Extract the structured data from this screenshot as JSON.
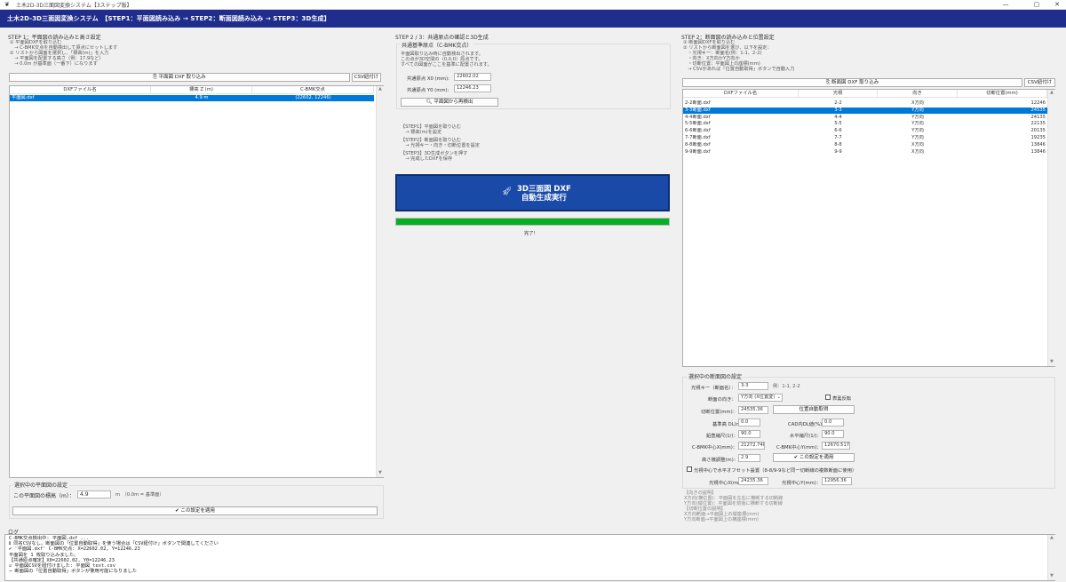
{
  "window": {
    "title": "土木2D-3D三面図変換システム【3ステップ版】",
    "controls": [
      "—",
      "▢",
      "✕"
    ]
  },
  "header": {
    "text": "土木2D-3D三面図変換システム　【STEP1：平面図読み込み → STEP2：断面図読み込み → STEP3：3D生成】"
  },
  "left": {
    "title": "STEP 1：平面図の読み込みと高さ設定",
    "instructions": [
      "① 平面図DXFを取り込む",
      "　→ C-BMK交点を自動検出して原点にセットします",
      "② リストから図面を選択し、「標高(m)」を入力",
      "　→ 平面図を配置する高さ（例：17.9など）",
      "　→ 0.0m が基準面（一番下）になります"
    ],
    "import_button": "平面図 DXF 取り込み",
    "csv_button": "CSV紐付け",
    "table": {
      "headers": [
        "DXFファイル名",
        "標高 Z (m)",
        "C-BMK交点"
      ],
      "rows": [
        [
          "平面図.dxf",
          "4.9 m",
          "(22602, 12246)"
        ]
      ]
    },
    "selected_group_title": "選択中の平面図の設定",
    "elevation_label": "この平面図の標高（m）：",
    "elevation_value": "4.9",
    "elevation_hint": "m　（0.0m = 基準面）",
    "apply_button": "✔ この設定を適用"
  },
  "middle": {
    "title": "STEP 2 / 3：共通原点の確認と3D生成",
    "origin_group_title": "共通基準原点（C-BMK交点）",
    "origin_desc": [
      "平面図取り込み時に自動検出されます。",
      "この点が3D空間の（0,0,0）原点です。",
      "すべての図面がここを基準に配置されます。"
    ],
    "x0_label": "共通原点 X0 (mm):",
    "x0_value": "22602.02",
    "y0_label": "共通原点 Y0 (mm):",
    "y0_value": "12246.23",
    "redetect_button": "平面図から再検出",
    "steps": [
      "【STEP1】平面図を取り込む",
      "　→ 標高(m)を設定",
      "【STEP2】断面図を取り込む",
      "　→ 光視キー・向き・切断位置を設定",
      "【STEP3】3D生成ボタンを押す",
      "　→ 完成したDXFを保存"
    ],
    "generate_line1": "3D三面図 DXF",
    "generate_line2": "自動生成実行",
    "progress": 1.0,
    "progress_text": "完了!"
  },
  "right": {
    "title": "STEP 2：断面図の読み込みと位置設定",
    "instructions": [
      "① 断面図DXFを取り込む",
      "② リストから断面図を選び、以下を設定：",
      "　・光視キー：断面名(例：1-1、2-2)",
      "　・向き：X方向かY方向か",
      "　・切断位置：平面図上の座標(mm)",
      "　→ CSVがあれば「位置自動取得」ボタンで自動入力"
    ],
    "import_button": "断面図 DXF 取り込み",
    "csv_button": "CSV紐付け",
    "table": {
      "headers": [
        "DXFファイル名",
        "光視",
        "向き",
        "切断位置(mm)"
      ],
      "rows": [
        [
          "2-2断面.dxf",
          "2-2",
          "X方向",
          "12246"
        ],
        [
          "3-3断面.dxf",
          "3-3",
          "Y方向",
          "24535"
        ],
        [
          "4-4断面.dxf",
          "4-4",
          "Y方向",
          "24135"
        ],
        [
          "5-5断面.dxf",
          "5-5",
          "Y方向",
          "22135"
        ],
        [
          "6-6断面.dxf",
          "6-6",
          "Y方向",
          "20135"
        ],
        [
          "7-7断面.dxf",
          "7-7",
          "Y方向",
          "19235"
        ],
        [
          "8-8断面.dxf",
          "8-8",
          "X方向",
          "13846"
        ],
        [
          "9-9断面.dxf",
          "9-9",
          "X方向",
          "13846"
        ]
      ],
      "selected_index": 1
    },
    "settings_title": "選択中の断面図の設定",
    "key_label": "光視キー（断面名）：",
    "key_value": "3-3",
    "key_hint": "例：1-1, 2-2",
    "direction_label": "断面の向き：",
    "direction_value": "Y方向 (X位置変)",
    "flip_label": "表裏反転",
    "cut_label": "切断位置(mm)：",
    "cut_value": "24535.36",
    "auto_button": "位置自動取得",
    "base_label": "基準高 DL(m)：",
    "base_value": "0.0",
    "cad_label": "CAD内DL値(%)：",
    "cad_value": "0.0",
    "vscale_label": "鉛直縮尺(1/)：",
    "vscale_value": "90.0",
    "hscale_label": "水平縮尺(1/)：",
    "hscale_value": "90.0",
    "bmkx_label": "C-BMK中心X(mm)：",
    "bmkx_value": "21272.7400",
    "bmky_label": "C-BMK中心Y(mm)：",
    "bmky_value": "12670.5170",
    "height_label": "高さ微調整(m)：",
    "height_value": "2.9",
    "apply_button": "✔ この設定を適用",
    "offset_label": "光視中心で水平オフセット設置（8-8/9-9など同一切断線の複数断面に使用）",
    "cx_label": "光視中心X(mm)：",
    "cx_value": "24235.36",
    "cy_label": "光視中心Y(mm)：",
    "cy_value": "12956.36",
    "notes": [
      "【向きの説明】",
      "X方向(横位置)：平面図を左右に横断する切断線",
      "Y方向(縦位置)：平面図を前後に横断する切断線",
      "【切断位置の説明】",
      "X方向断面→平面図上の縦座標(mm)",
      "Y方向断面→平面図上の横座標(mm)"
    ]
  },
  "log": {
    "title": "ログ",
    "lines": [
      "C-BMK交点検出中: 平面図.dxf ...",
      "ℹ 同名CSVなし。断面図の「位置自動取得」を使う場合は「CSV紐付け」ボタンで関連してください",
      "✔ '平面図.dxf' C-BMK交点: X=22602.02, Y=12246.23",
      "平面図を 1 枚取り込みました。",
      "【共通原点確定】X0=22602.02, Y0=12246.23",
      "☑ 平面図CSVを紐付けました: 平面図_text.csv",
      "→ 断面図の「位置自動取得」ボタンが使用可能になりました"
    ]
  }
}
